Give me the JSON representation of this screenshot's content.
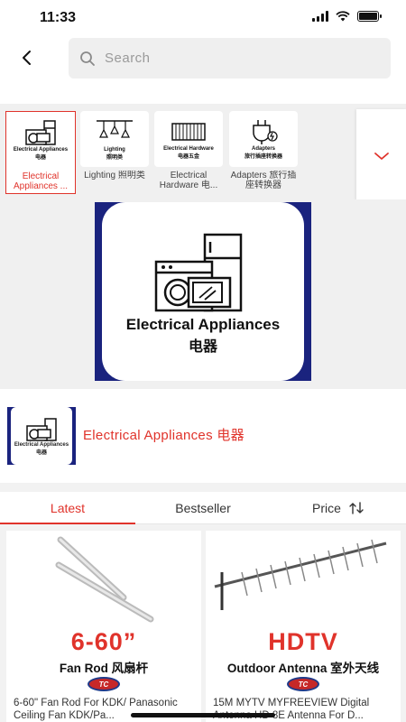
{
  "status_bar": {
    "time": "11:33"
  },
  "search": {
    "placeholder": "Search"
  },
  "categories": [
    {
      "label": "Electrical Appliances ...",
      "thumb_text": "Electrical Appliances",
      "thumb_cn": "电器",
      "selected": true
    },
    {
      "label": "Lighting 照明类",
      "thumb_text": "Lighting",
      "thumb_cn": "照明类",
      "selected": false
    },
    {
      "label": "Electrical Hardware 电...",
      "thumb_text": "Electrical Hardware",
      "thumb_cn": "电器五金",
      "selected": false
    },
    {
      "label": "Adapters 旅行插座转换器",
      "thumb_text": "Adapters",
      "thumb_cn": "旅行插座转换器",
      "selected": false
    }
  ],
  "banner": {
    "title": "Electrical Appliances",
    "title_cn": "电器"
  },
  "brand": {
    "name": "Electrical Appliances 电器",
    "logo_text": "Electrical Appliances",
    "logo_cn": "电器"
  },
  "tabs": [
    {
      "label": "Latest",
      "active": true
    },
    {
      "label": "Bestseller",
      "active": false
    },
    {
      "label": "Price",
      "active": false
    }
  ],
  "products": [
    {
      "title": "6-60\" Fan Rod For KDK/ Panasonic Ceiling Fan KDK/Pa...",
      "promo_big": "6-60”",
      "promo_sub": "Fan Rod 风扇杆",
      "badge": "TC"
    },
    {
      "title": "15M MYTV MYFREEVIEW Digital Antenna HD 8E Antenna For D...",
      "promo_big": "HDTV",
      "promo_sub": "Outdoor Antenna 室外天线",
      "badge": "TC"
    }
  ],
  "colors": {
    "accent": "#e0332b",
    "brand_navy": "#1a237e",
    "background": "#f0f0f0"
  }
}
